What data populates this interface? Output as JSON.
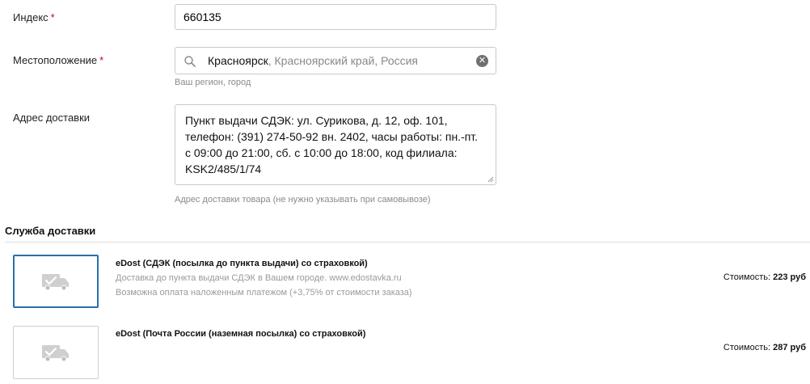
{
  "form": {
    "index": {
      "label": "Индекс",
      "required_mark": "*",
      "value": "660135"
    },
    "location": {
      "label": "Местоположение",
      "required_mark": "*",
      "city": "Красноярск",
      "rest": ", Красноярский край, Россия",
      "hint": "Ваш регион, город",
      "search_icon": "search-icon",
      "clear_icon": "clear-icon"
    },
    "address": {
      "label": "Адрес доставки",
      "value": "Пункт выдачи СДЭК: ул. Сурикова, д. 12, оф. 101, телефон: (391) 274-50-92 вн. 2402, часы работы: пн.-пт. с 09:00 до 21:00, сб. с 10:00 до 18:00, код филиала: KSK2/485/1/74",
      "hint": "Адрес доставки товара (не нужно указывать при самовывозе)"
    }
  },
  "delivery": {
    "section_title": "Служба доставки",
    "services": [
      {
        "title": "eDost (СДЭК (посылка до пункта выдачи) со страховкой)",
        "desc1": "Доставка до пункта выдачи СДЭК в Вашем городе. www.edostavka.ru",
        "desc2": "Возможна оплата наложенным платежом (+3,75% от стоимости заказа)",
        "price_label": "Стоимость:",
        "price_value": "223 руб",
        "selected": true,
        "icon": "truck-check-icon"
      },
      {
        "title": "eDost (Почта России (наземная посылка) со страховкой)",
        "price_label": "Стоимость:",
        "price_value": "287 руб",
        "selected": false,
        "icon": "truck-check-icon"
      }
    ]
  },
  "colors": {
    "required": "#d0021b",
    "selected_border": "#2a6fa8",
    "hint_text": "#8a8a8a"
  }
}
